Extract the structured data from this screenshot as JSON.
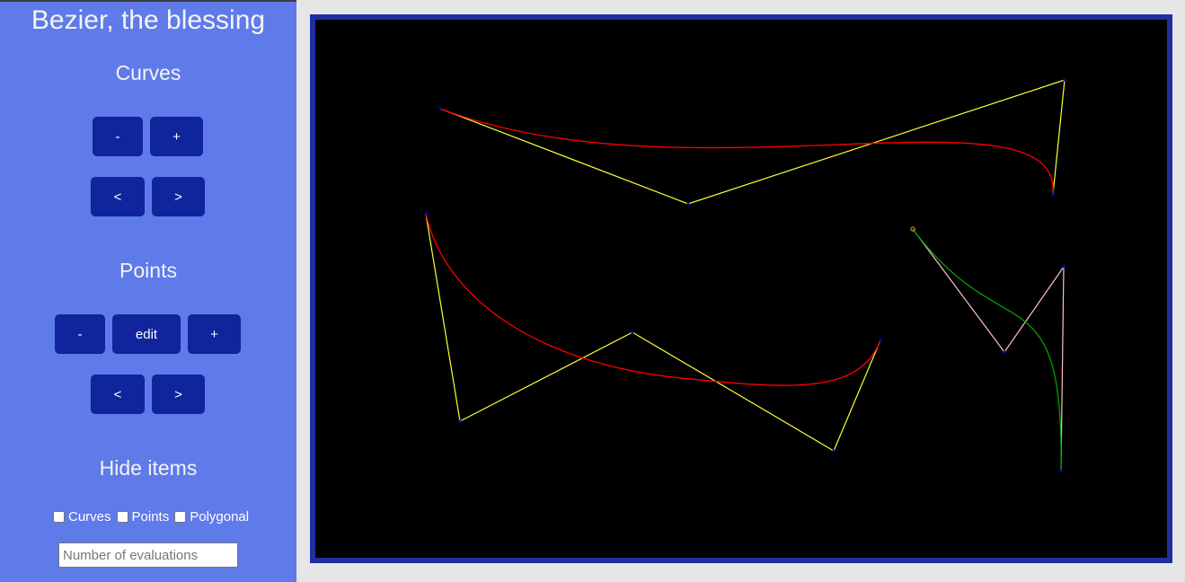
{
  "app": {
    "title": "Bezier, the blessing"
  },
  "curves_section": {
    "title": "Curves",
    "remove_label": "-",
    "add_label": "+",
    "prev_label": "<",
    "next_label": ">"
  },
  "points_section": {
    "title": "Points",
    "remove_label": "-",
    "edit_label": "edit",
    "add_label": "+",
    "prev_label": "<",
    "next_label": ">"
  },
  "hide_section": {
    "title": "Hide items",
    "options": [
      {
        "label": "Curves",
        "checked": false
      },
      {
        "label": "Points",
        "checked": false
      },
      {
        "label": "Polygonal",
        "checked": false
      }
    ],
    "evaluations_placeholder": "Number of evaluations"
  },
  "colors": {
    "sidebar": "#5f7ae9",
    "button": "#10249b",
    "canvas_border": "#1f2fa0",
    "canvas_bg": "#000000",
    "curve": "#ff0000",
    "polygon": "#ffff33",
    "selected_curve": "#00a000",
    "selected_polygon": "#ffc0cb",
    "point": "#0000ff",
    "selected_point": "#ffa500"
  }
}
